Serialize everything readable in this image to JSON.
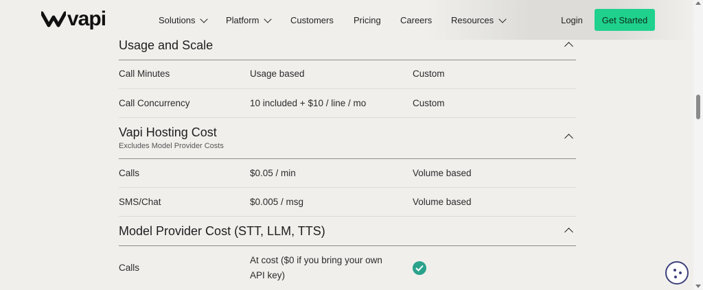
{
  "brand": {
    "logo_text": "vapi"
  },
  "nav": {
    "solutions": "Solutions",
    "platform": "Platform",
    "customers": "Customers",
    "pricing": "Pricing",
    "careers": "Careers",
    "resources": "Resources"
  },
  "actions": {
    "login": "Login",
    "get_started": "Get Started"
  },
  "sections": [
    {
      "title": "Usage and Scale",
      "rows": [
        {
          "label": "Call Minutes",
          "value": "Usage based",
          "custom": "Custom"
        },
        {
          "label": "Call Concurrency",
          "value": "10 included + $10 / line / mo",
          "custom": "Custom"
        }
      ]
    },
    {
      "title": "Vapi Hosting Cost",
      "subtitle": "Excludes Model Provider Costs",
      "rows": [
        {
          "label": "Calls",
          "value": "$0.05 / min",
          "custom": "Volume based"
        },
        {
          "label": "SMS/Chat",
          "value": "$0.005 / msg",
          "custom": "Volume based"
        }
      ]
    },
    {
      "title": "Model Provider Cost (STT, LLM, TTS)",
      "rows": [
        {
          "label": "Calls",
          "value": "At cost ($0 if you bring your own API key)"
        }
      ]
    }
  ],
  "colors": {
    "accent": "#1fd18d",
    "check": "#2aa28c",
    "background": "#f0efec"
  },
  "icons": {
    "caret": "chevron-up-icon",
    "check": "check-circle-icon",
    "cookie": "cookie-icon"
  }
}
